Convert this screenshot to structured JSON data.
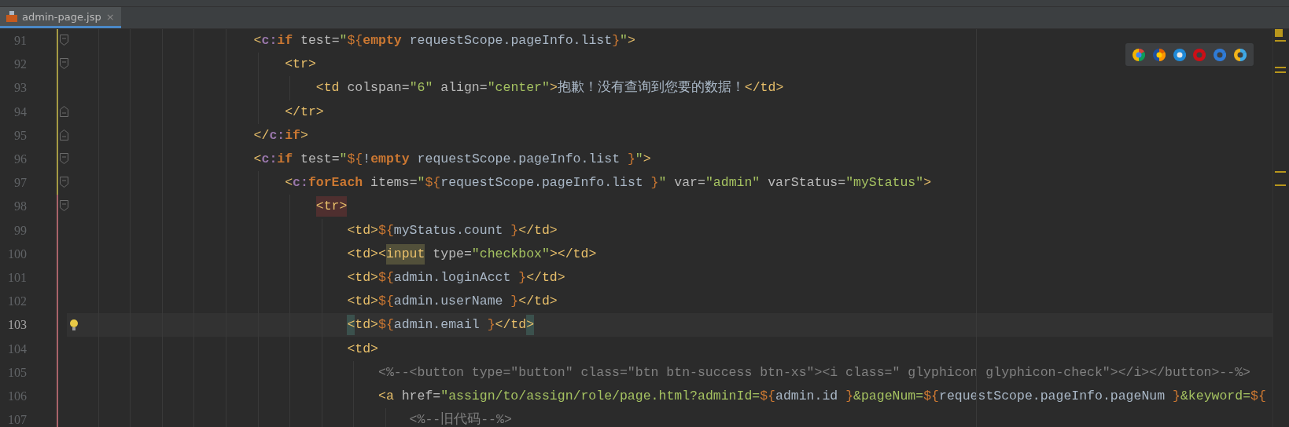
{
  "tabs": [
    {
      "label": "admin-page.jsp",
      "selected": true,
      "close": "×"
    }
  ],
  "lines": [
    {
      "number": "91",
      "color": "#a59a44",
      "fold_start": true,
      "fold_end": false,
      "current": false,
      "bulb": false,
      "tokens": [
        {
          "kind": "tag",
          "text": "<"
        },
        {
          "kind": "ns",
          "text": "c:"
        },
        {
          "kind": "kw",
          "text": "if"
        },
        {
          "kind": "attr",
          "text": " test="
        },
        {
          "kind": "str",
          "text": "\""
        },
        {
          "kind": "el",
          "text": "${"
        },
        {
          "kind": "kw",
          "text": "empty"
        },
        {
          "kind": "text",
          "text": " requestScope.pageInfo.list"
        },
        {
          "kind": "el",
          "text": "}"
        },
        {
          "kind": "str",
          "text": "\""
        },
        {
          "kind": "tag",
          "text": ">"
        }
      ],
      "children": [
        {
          "number": "92",
          "color": "#a59a44",
          "fold_start": true,
          "fold_end": false,
          "current": false,
          "bulb": false,
          "tokens": [
            {
              "kind": "tag",
              "text": "<tr>"
            }
          ],
          "children": [
            {
              "number": "93",
              "color": "#a59a44",
              "fold_start": false,
              "fold_end": false,
              "current": false,
              "bulb": false,
              "tokens": [
                {
                  "kind": "tag",
                  "text": "<td"
                },
                {
                  "kind": "attr",
                  "text": " colspan="
                },
                {
                  "kind": "str",
                  "text": "\"6\""
                },
                {
                  "kind": "attr",
                  "text": " align="
                },
                {
                  "kind": "str",
                  "text": "\"center\""
                },
                {
                  "kind": "tag",
                  "text": ">"
                },
                {
                  "kind": "text",
                  "text": "抱歉！没有查询到您要的数据！"
                },
                {
                  "kind": "tag",
                  "text": "</td>"
                }
              ]
            }
          ]
        },
        {
          "number": "94",
          "color": "#a59a44",
          "fold_start": false,
          "fold_end": true,
          "current": false,
          "bulb": false,
          "tokens": [
            {
              "kind": "tag",
              "text": "</tr>"
            }
          ]
        }
      ]
    },
    {
      "number": "95",
      "color": "#a59a44",
      "fold_start": false,
      "fold_end": true,
      "current": false,
      "bulb": false,
      "tokens": [
        {
          "kind": "tag",
          "text": "</"
        },
        {
          "kind": "ns",
          "text": "c:"
        },
        {
          "kind": "kw",
          "text": "if"
        },
        {
          "kind": "tag",
          "text": ">"
        }
      ]
    },
    {
      "number": "96",
      "color": "#a59a44",
      "fold_start": true,
      "fold_end": false,
      "current": false,
      "bulb": false,
      "tokens": [
        {
          "kind": "tag",
          "text": "<"
        },
        {
          "kind": "ns",
          "text": "c:"
        },
        {
          "kind": "kw",
          "text": "if"
        },
        {
          "kind": "attr",
          "text": " test="
        },
        {
          "kind": "str",
          "text": "\""
        },
        {
          "kind": "el",
          "text": "${"
        },
        {
          "kind": "text",
          "text": "!"
        },
        {
          "kind": "kw",
          "text": "empty"
        },
        {
          "kind": "text",
          "text": " requestScope.pageInfo.list "
        },
        {
          "kind": "el",
          "text": "}"
        },
        {
          "kind": "str",
          "text": "\""
        },
        {
          "kind": "tag",
          "text": ">"
        }
      ],
      "children": [
        {
          "number": "97",
          "color": "#a59a44",
          "fold_start": true,
          "fold_end": false,
          "current": false,
          "bulb": false,
          "tokens": [
            {
              "kind": "tag",
              "text": "<"
            },
            {
              "kind": "ns",
              "text": "c:"
            },
            {
              "kind": "kw",
              "text": "forEach"
            },
            {
              "kind": "attr",
              "text": " items="
            },
            {
              "kind": "str",
              "text": "\""
            },
            {
              "kind": "el",
              "text": "${"
            },
            {
              "kind": "text",
              "text": "requestScope.pageInfo.list "
            },
            {
              "kind": "el",
              "text": "}"
            },
            {
              "kind": "str",
              "text": "\""
            },
            {
              "kind": "attr",
              "text": " var="
            },
            {
              "kind": "str",
              "text": "\"admin\""
            },
            {
              "kind": "attr",
              "text": " varStatus="
            },
            {
              "kind": "str",
              "text": "\"myStatus\""
            },
            {
              "kind": "tag",
              "text": ">"
            }
          ],
          "children": [
            {
              "number": "98",
              "color": "#a8636a",
              "fold_start": true,
              "fold_end": false,
              "current": false,
              "bulb": false,
              "tokens": [
                {
                  "kind": "tag",
                  "text": "<tr>",
                  "color": "#4f2f2f"
                }
              ],
              "children": [
                {
                  "number": "99",
                  "color": "#a8636a",
                  "fold_start": false,
                  "fold_end": false,
                  "current": false,
                  "bulb": false,
                  "tokens": [
                    {
                      "kind": "tag",
                      "text": "<td>"
                    },
                    {
                      "kind": "el",
                      "text": "${"
                    },
                    {
                      "kind": "text",
                      "text": "myStatus.count "
                    },
                    {
                      "kind": "el",
                      "text": "}"
                    },
                    {
                      "kind": "tag",
                      "text": "</td>"
                    }
                  ]
                },
                {
                  "number": "100",
                  "color": "#a8636a",
                  "fold_start": false,
                  "fold_end": false,
                  "current": false,
                  "bulb": false,
                  "tokens": [
                    {
                      "kind": "tag",
                      "text": "<td><"
                    },
                    {
                      "kind": "tag",
                      "text": "input",
                      "color": "#52503a"
                    },
                    {
                      "kind": "attr",
                      "text": " type="
                    },
                    {
                      "kind": "str",
                      "text": "\"checkbox\""
                    },
                    {
                      "kind": "tag",
                      "text": "></td>"
                    }
                  ]
                },
                {
                  "number": "101",
                  "color": "#a8636a",
                  "fold_start": false,
                  "fold_end": false,
                  "current": false,
                  "bulb": false,
                  "tokens": [
                    {
                      "kind": "tag",
                      "text": "<td>"
                    },
                    {
                      "kind": "el",
                      "text": "${"
                    },
                    {
                      "kind": "text",
                      "text": "admin.loginAcct "
                    },
                    {
                      "kind": "el",
                      "text": "}"
                    },
                    {
                      "kind": "tag",
                      "text": "</td>"
                    }
                  ]
                },
                {
                  "number": "102",
                  "color": "#a8636a",
                  "fold_start": false,
                  "fold_end": false,
                  "current": false,
                  "bulb": false,
                  "tokens": [
                    {
                      "kind": "tag",
                      "text": "<td>"
                    },
                    {
                      "kind": "el",
                      "text": "${"
                    },
                    {
                      "kind": "text",
                      "text": "admin.userName "
                    },
                    {
                      "kind": "el",
                      "text": "}"
                    },
                    {
                      "kind": "tag",
                      "text": "</td>"
                    }
                  ]
                },
                {
                  "number": "103",
                  "color": "#a8636a",
                  "fold_start": false,
                  "fold_end": false,
                  "current": true,
                  "bulb": true,
                  "tokens": [
                    {
                      "kind": "tag",
                      "text": "<",
                      "color": "#3b514d"
                    },
                    {
                      "kind": "tag",
                      "text": "td>"
                    },
                    {
                      "kind": "el",
                      "text": "${"
                    },
                    {
                      "kind": "text",
                      "text": "admin.email "
                    },
                    {
                      "kind": "el",
                      "text": "}"
                    },
                    {
                      "kind": "tag",
                      "text": "</td"
                    },
                    {
                      "kind": "tag",
                      "text": ">",
                      "color": "#3b514d"
                    }
                  ]
                },
                {
                  "number": "104",
                  "color": "#a8636a",
                  "fold_start": false,
                  "fold_end": false,
                  "current": false,
                  "bulb": false,
                  "tokens": [
                    {
                      "kind": "tag",
                      "text": "<td>"
                    }
                  ],
                  "children": [
                    {
                      "number": "105",
                      "color": "#a8636a",
                      "fold_start": false,
                      "fold_end": false,
                      "current": false,
                      "bulb": false,
                      "tokens": [
                        {
                          "kind": "comment",
                          "text": "<%--<button type=\"button\" class=\"btn btn-success btn-xs\"><i class=\" glyphicon glyphicon-check\"></i></button>--%>"
                        }
                      ]
                    },
                    {
                      "number": "106",
                      "color": "#a8636a",
                      "fold_start": false,
                      "fold_end": false,
                      "current": false,
                      "bulb": false,
                      "tokens": [
                        {
                          "kind": "tag",
                          "text": "<a"
                        },
                        {
                          "kind": "attr",
                          "text": " href="
                        },
                        {
                          "kind": "str",
                          "text": "\"assign/to/assign/role/page.html?adminId="
                        },
                        {
                          "kind": "el",
                          "text": "${"
                        },
                        {
                          "kind": "text",
                          "text": "admin.id "
                        },
                        {
                          "kind": "el",
                          "text": "}"
                        },
                        {
                          "kind": "str",
                          "text": "&pageNum="
                        },
                        {
                          "kind": "el",
                          "text": "${"
                        },
                        {
                          "kind": "text",
                          "text": "requestScope.pageInfo.pageNum "
                        },
                        {
                          "kind": "el",
                          "text": "}"
                        },
                        {
                          "kind": "str",
                          "text": "&keyword="
                        },
                        {
                          "kind": "el",
                          "text": "${"
                        }
                      ],
                      "children": [
                        {
                          "number": "107",
                          "color": "#a8636a",
                          "fold_start": false,
                          "fold_end": false,
                          "current": false,
                          "bulb": false,
                          "tokens": [
                            {
                              "kind": "comment",
                              "text": "<%--旧代码--%>"
                            }
                          ]
                        }
                      ]
                    }
                  ]
                }
              ]
            }
          ]
        }
      ]
    }
  ]
}
